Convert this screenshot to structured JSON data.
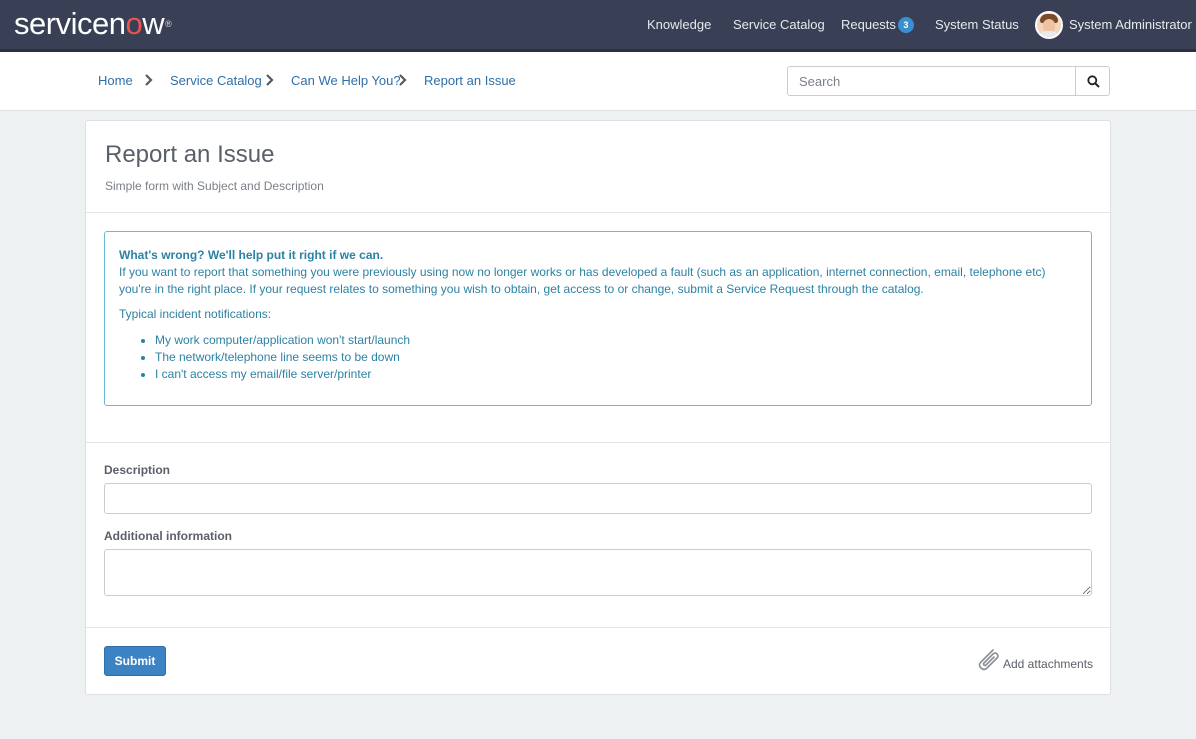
{
  "navbar": {
    "logo": {
      "service": "service",
      "n": "n",
      "o": "o",
      "w": "w",
      "reg": "®"
    },
    "links": {
      "knowledge": "Knowledge",
      "service_catalog": "Service Catalog",
      "requests": "Requests",
      "requests_count": "3",
      "system_status": "System Status"
    },
    "user": {
      "name": "System Administrator",
      "avatar_icon": "user-avatar"
    },
    "colors": {
      "background": "#394055",
      "badge": "#3a8fd1",
      "logo_accent": "#e8554e"
    }
  },
  "breadcrumb": {
    "items": [
      "Home",
      "Service Catalog",
      "Can We Help You?",
      "Report an Issue"
    ],
    "separator_icon": "chevron-right-icon"
  },
  "search": {
    "placeholder": "Search",
    "value": "",
    "button_icon": "search-icon"
  },
  "form": {
    "title": "Report an Issue",
    "subtitle": "Simple form with Subject and Description",
    "info": {
      "heading": "What's wrong? We'll help put it right if we can.",
      "body": "If you want to report that something you were previously using now no longer works or has developed a fault (such as an application, internet connection, email, telephone etc) you're in the right place. If your request relates to something you wish to obtain, get access to or change, submit a Service Request through the catalog.",
      "typical": "Typical incident notifications:",
      "examples": [
        "My work computer/application won't start/launch",
        "The network/telephone line seems to be down",
        "I can't access my email/file server/printer"
      ],
      "color": "#2c82a3",
      "border_color": "#66bcd6"
    },
    "fields": {
      "description": {
        "label": "Description",
        "value": ""
      },
      "additional_information": {
        "label": "Additional information",
        "value": ""
      }
    },
    "submit_label": "Submit",
    "submit_color": "#3c83c4",
    "attach_label": "Add attachments",
    "attach_icon": "paperclip-icon"
  }
}
